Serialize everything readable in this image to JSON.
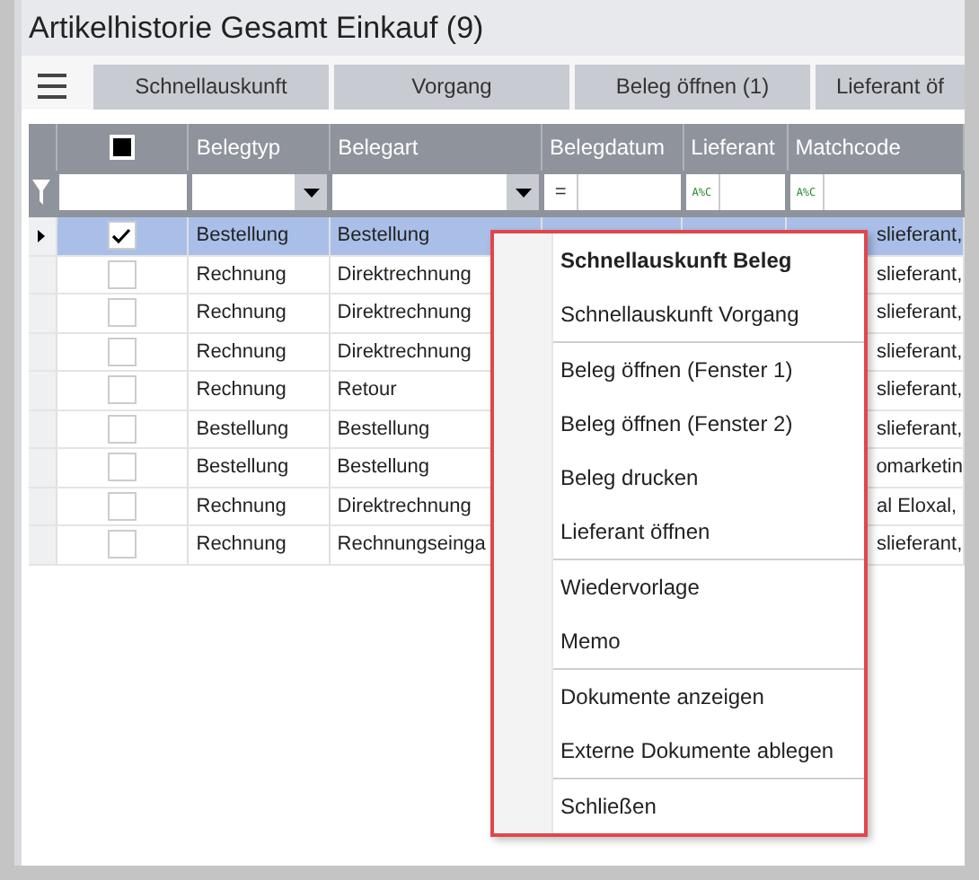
{
  "window": {
    "title": "Artikelhistorie Gesamt Einkauf (9)"
  },
  "toolbar": {
    "buttons": [
      "Schnellauskunft",
      "Vorgang",
      "Beleg öffnen (1)",
      "Lieferant öf"
    ]
  },
  "table": {
    "select_all": {
      "indeterminate": true
    },
    "columns": [
      "Belegtyp",
      "Belegart",
      "Belegdatum",
      "Lieferant",
      "Matchcode"
    ],
    "filters": [
      {
        "kind": "text"
      },
      {
        "kind": "dropdown"
      },
      {
        "kind": "dropdown"
      },
      {
        "kind": "operator",
        "label": "="
      },
      {
        "kind": "operator",
        "label": "A%C"
      },
      {
        "kind": "operator",
        "label": "A%C"
      }
    ],
    "rows": [
      {
        "selected": true,
        "checked": true,
        "belegtyp": "Bestellung",
        "belegart": "Bestellung",
        "matchcode": "slieferant,"
      },
      {
        "selected": false,
        "checked": false,
        "belegtyp": "Rechnung",
        "belegart": "Direktrechnung",
        "matchcode": "slieferant,"
      },
      {
        "selected": false,
        "checked": false,
        "belegtyp": "Rechnung",
        "belegart": "Direktrechnung",
        "matchcode": "slieferant,"
      },
      {
        "selected": false,
        "checked": false,
        "belegtyp": "Rechnung",
        "belegart": "Direktrechnung",
        "matchcode": "slieferant,"
      },
      {
        "selected": false,
        "checked": false,
        "belegtyp": "Rechnung",
        "belegart": "Retour",
        "matchcode": "slieferant,"
      },
      {
        "selected": false,
        "checked": false,
        "belegtyp": "Bestellung",
        "belegart": "Bestellung",
        "matchcode": "slieferant,"
      },
      {
        "selected": false,
        "checked": false,
        "belegtyp": "Bestellung",
        "belegart": "Bestellung",
        "matchcode": "omarketin"
      },
      {
        "selected": false,
        "checked": false,
        "belegtyp": "Rechnung",
        "belegart": "Direktrechnung",
        "matchcode": "al Eloxal,"
      },
      {
        "selected": false,
        "checked": false,
        "belegtyp": "Rechnung",
        "belegart": "Rechnungseinga",
        "matchcode": "slieferant,"
      }
    ]
  },
  "context_menu": {
    "items": [
      {
        "label": "Schnellauskunft Beleg",
        "default": true,
        "separator_before": false
      },
      {
        "label": "Schnellauskunft Vorgang",
        "default": false,
        "separator_before": false
      },
      {
        "label": "Beleg öffnen (Fenster 1)",
        "default": false,
        "separator_before": true
      },
      {
        "label": "Beleg öffnen (Fenster 2)",
        "default": false,
        "separator_before": false
      },
      {
        "label": "Beleg drucken",
        "default": false,
        "separator_before": false
      },
      {
        "label": "Lieferant öffnen",
        "default": false,
        "separator_before": false
      },
      {
        "label": "Wiedervorlage",
        "default": false,
        "separator_before": true
      },
      {
        "label": "Memo",
        "default": false,
        "separator_before": false
      },
      {
        "label": "Dokumente anzeigen",
        "default": false,
        "separator_before": true
      },
      {
        "label": "Externe Dokumente ablegen",
        "default": false,
        "separator_before": false
      },
      {
        "label": "Schließen",
        "default": false,
        "separator_before": true
      }
    ]
  }
}
